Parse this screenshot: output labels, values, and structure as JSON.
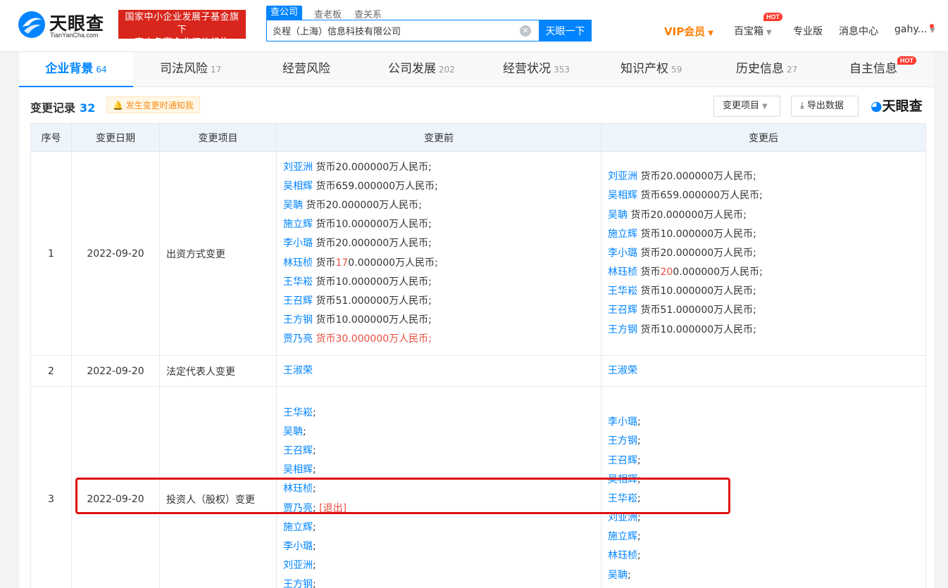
{
  "header": {
    "logo_text": "天眼查",
    "logo_sub": "TianYanCha.com",
    "badge_line1": "国家中小企业发展子基金旗下",
    "badge_line2": "官方备案企业征信机构",
    "search_tabs": [
      "查公司",
      "查老板",
      "查关系"
    ],
    "search_value": "炎程（上海）信息科技有限公司",
    "search_button": "天眼一下",
    "vip": "VIP会员",
    "baibaoxiang": "百宝箱",
    "hot": "HOT",
    "pro": "专业版",
    "messages": "消息中心",
    "user": "gahy..."
  },
  "tabs": [
    {
      "label": "企业背景",
      "count": "64"
    },
    {
      "label": "司法风险",
      "count": "17"
    },
    {
      "label": "经营风险",
      "count": ""
    },
    {
      "label": "公司发展",
      "count": "202"
    },
    {
      "label": "经营状况",
      "count": "353"
    },
    {
      "label": "知识产权",
      "count": "59"
    },
    {
      "label": "历史信息",
      "count": "27"
    },
    {
      "label": "自主信息",
      "count": ""
    }
  ],
  "section": {
    "title": "变更记录",
    "count": "32",
    "notify": "发生变更时通知我",
    "filter_button": "变更项目",
    "export_button": "导出数据",
    "brand": "天眼查"
  },
  "table": {
    "headers": [
      "序号",
      "变更日期",
      "变更项目",
      "变更前",
      "变更后"
    ],
    "rows": [
      {
        "no": "1",
        "date": "2022-09-20",
        "item": "出资方式变更",
        "before": [
          {
            "name": "刘亚洲",
            "text": " 货币20.000000万人民币;"
          },
          {
            "name": "吴相辉",
            "text": " 货币659.000000万人民币;"
          },
          {
            "name": "吴聃",
            "text": " 货币20.000000万人民币;"
          },
          {
            "name": "施立辉",
            "text": " 货币10.000000万人民币;"
          },
          {
            "name": "李小璐",
            "text": " 货币20.000000万人民币;"
          },
          {
            "name": "林珏桢",
            "pre": " 货币",
            "hl": "17",
            "post": "0.000000万人民币;"
          },
          {
            "name": "王华崧",
            "text": " 货币10.000000万人民币;"
          },
          {
            "name": "王召辉",
            "text": " 货币51.000000万人民币;"
          },
          {
            "name": "王方钢",
            "text": " 货币10.000000万人民币;"
          },
          {
            "name": "贾乃亮",
            "hl": " 货币30.000000万人民币;"
          }
        ],
        "after": [
          {
            "name": "刘亚洲",
            "text": " 货币20.000000万人民币;"
          },
          {
            "name": "吴相辉",
            "text": " 货币659.000000万人民币;"
          },
          {
            "name": "吴聃",
            "text": " 货币20.000000万人民币;"
          },
          {
            "name": "施立辉",
            "text": " 货币10.000000万人民币;"
          },
          {
            "name": "李小璐",
            "text": " 货币20.000000万人民币;"
          },
          {
            "name": "林珏桢",
            "pre": " 货币",
            "hl": "20",
            "post": "0.000000万人民币;"
          },
          {
            "name": "王华崧",
            "text": " 货币10.000000万人民币;"
          },
          {
            "name": "王召辉",
            "text": " 货币51.000000万人民币;"
          },
          {
            "name": "王方钢",
            "text": " 货币10.000000万人民币;"
          }
        ]
      },
      {
        "no": "2",
        "date": "2022-09-20",
        "item": "法定代表人变更",
        "before": [
          {
            "name": "王淑荣"
          }
        ],
        "after": [
          {
            "name": "王淑荣"
          }
        ]
      },
      {
        "no": "3",
        "date": "2022-09-20",
        "item": "投资人（股权）变更",
        "before": [
          {
            "name": "王华崧",
            "text": ";"
          },
          {
            "name": "吴聃",
            "text": ";"
          },
          {
            "name": "王召辉",
            "text": ";"
          },
          {
            "name": "吴相辉",
            "text": ";"
          },
          {
            "name": "林珏桢",
            "text": ";"
          },
          {
            "name": "贾乃亮",
            "text": "; ",
            "hl": "[退出]"
          },
          {
            "name": "施立辉",
            "text": ";"
          },
          {
            "name": "李小璐",
            "text": ";"
          },
          {
            "name": "刘亚洲",
            "text": ";"
          },
          {
            "name": "王方钢",
            "text": ";"
          }
        ],
        "after": [
          {
            "name": "李小璐",
            "text": ";"
          },
          {
            "name": "王方钢",
            "text": ";"
          },
          {
            "name": "王召辉",
            "text": ";"
          },
          {
            "name": "吴相辉",
            "text": ";"
          },
          {
            "name": "王华崧",
            "text": ";"
          },
          {
            "name": "刘亚洲",
            "text": ";"
          },
          {
            "name": "施立辉",
            "text": ";"
          },
          {
            "name": "林珏桢",
            "text": ";"
          },
          {
            "name": "吴聃",
            "text": ";"
          }
        ]
      }
    ]
  },
  "colors": {
    "brand_blue": "#0084ff",
    "highlight_red": "#e84e40",
    "annotation_red": "#e01010",
    "vip_orange": "#ff7d00"
  }
}
